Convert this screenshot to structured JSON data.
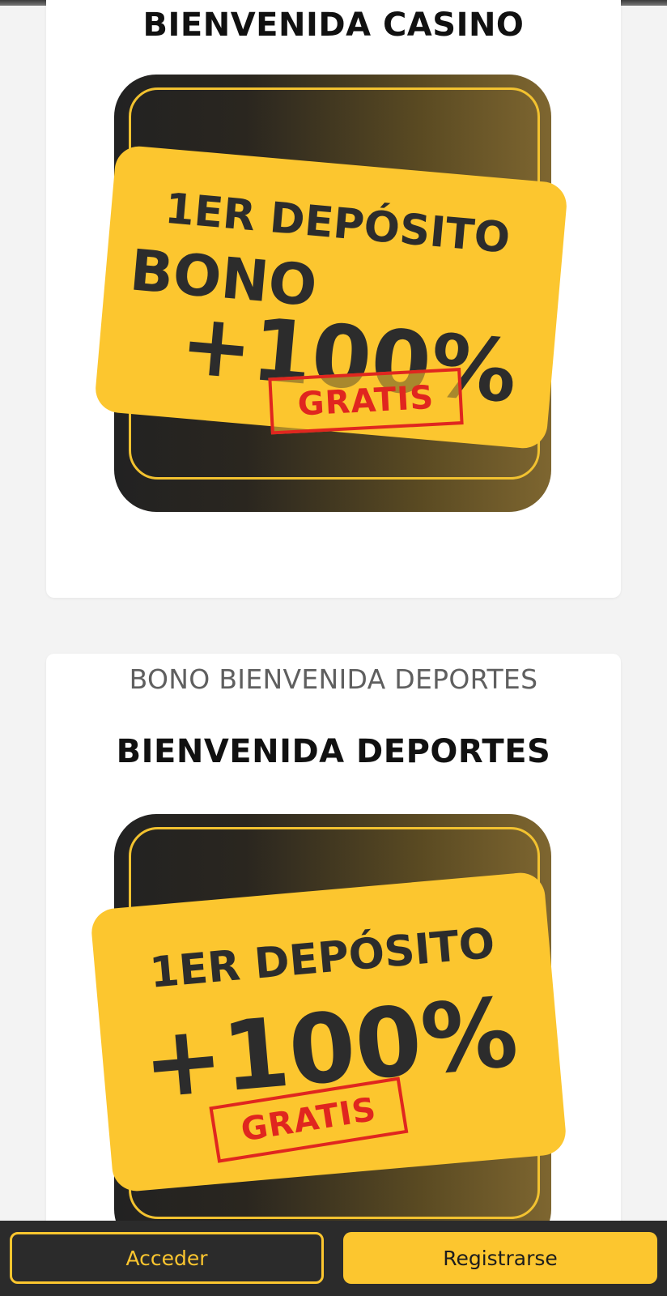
{
  "cards": [
    {
      "title": "BIENVENIDA CASINO",
      "promo": {
        "line1": "1ER DEPÓSITO",
        "line2": "BONO",
        "line3": "+100%",
        "stamp": "GRATIS"
      }
    },
    {
      "subtitle": "BONO BIENVENIDA DEPORTES",
      "title": "BIENVENIDA DEPORTES",
      "promo": {
        "line1": "1ER DEPÓSITO",
        "line3": "+100%",
        "stamp": "GRATIS"
      }
    }
  ],
  "bottom_bar": {
    "login_label": "Acceder",
    "register_label": "Registrarse"
  },
  "colors": {
    "accent": "#fcc62f",
    "stamp": "#e0261f",
    "dark": "#2b2b2b"
  }
}
